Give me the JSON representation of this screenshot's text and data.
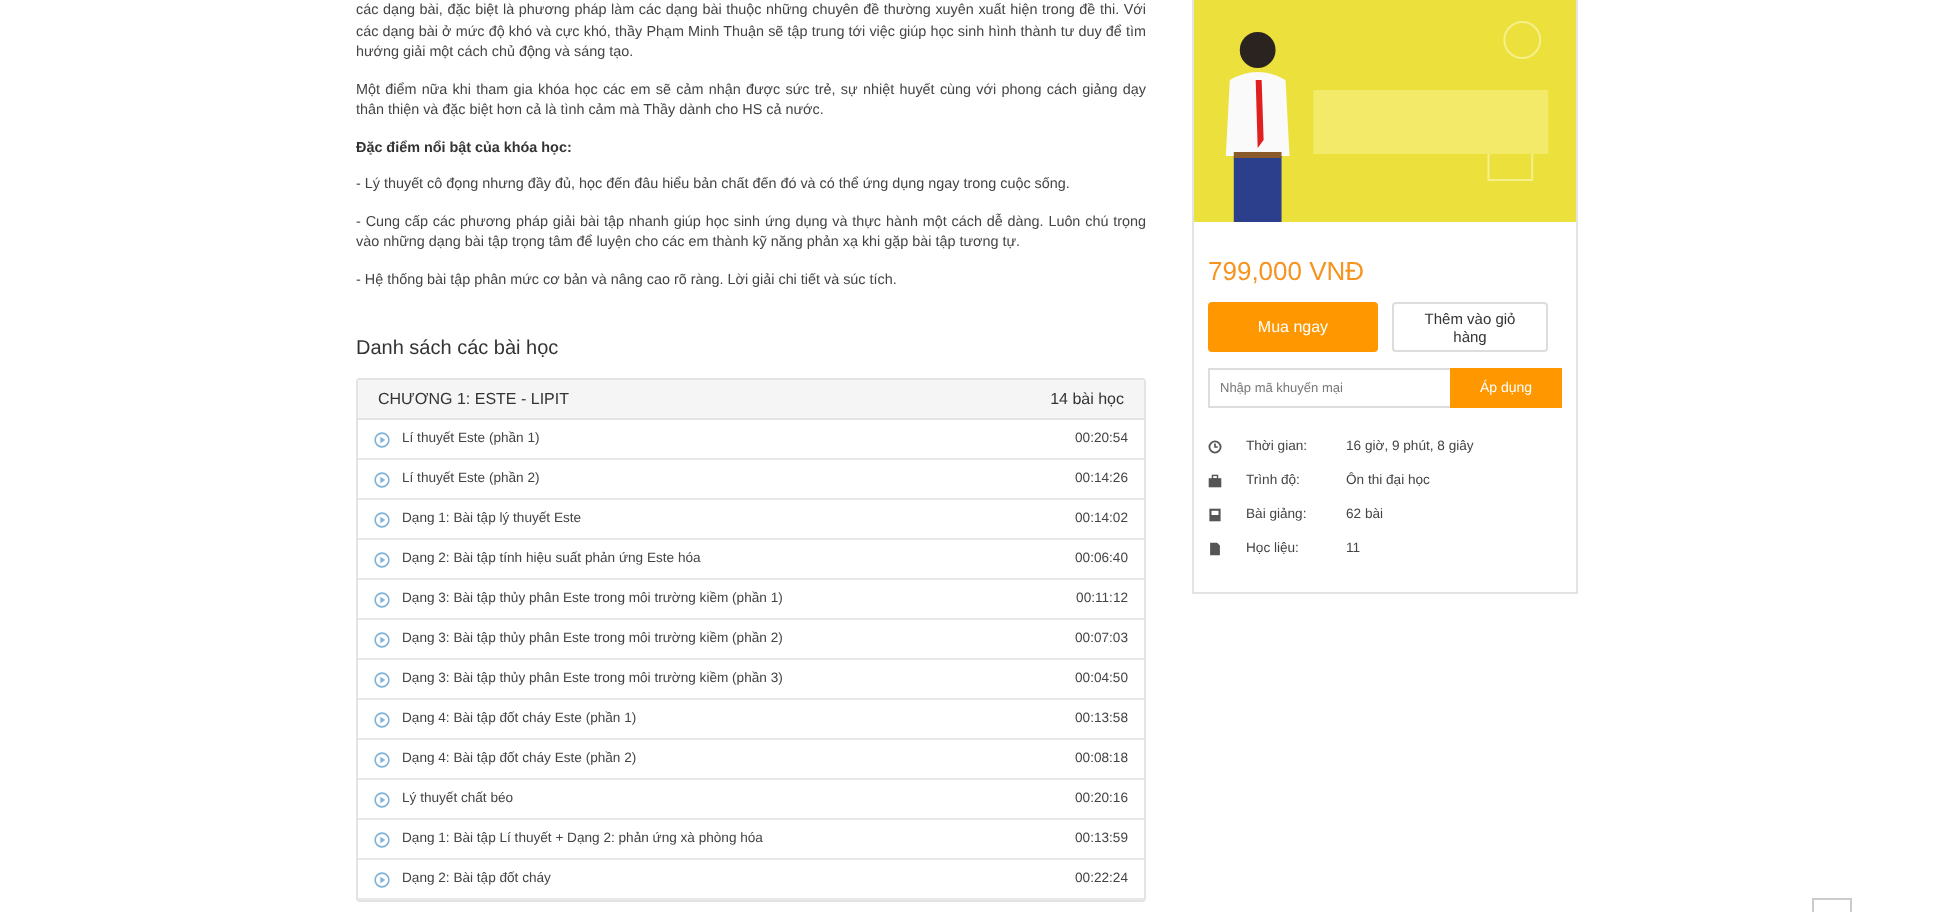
{
  "description": {
    "paragraphs": [
      "các dạng bài, đặc biệt là phương pháp làm các dạng bài thuộc những chuyên đề thường xuyên xuất hiện trong đề thi. Với các dạng bài ở mức độ khó và cực khó, thầy Phạm Minh Thuận sẽ tập trung tới việc giúp học sinh hình thành tư duy để tìm hướng giải một cách chủ động và sáng tạo.",
      "Một điểm nữa khi tham gia khóa học các em sẽ cảm nhận được sức trẻ, sự nhiệt huyết cùng với phong cách giảng dạy thân thiện và đặc biệt hơn cả là tình cảm mà Thầy dành cho HS cả nước."
    ],
    "features_heading": "Đặc điểm nổi bật của khóa học:",
    "features": [
      "- Lý thuyết cô đọng nhưng đầy đủ, học đến đâu hiểu bản chất đến đó và có thể ứng dụng ngay trong cuộc sống.",
      "- Cung cấp các phương pháp giải bài tập nhanh giúp học sinh ứng dụng và thực hành một cách dễ dàng. Luôn chú trọng vào những dạng bài tập trọng tâm để luyện cho các em thành kỹ năng phản xạ khi gặp bài tập tương tự.",
      "- Hệ thống bài tập phân mức cơ bản và nâng cao rõ ràng. Lời giải chi tiết và súc tích."
    ]
  },
  "lessons": {
    "title": "Danh sách các bài học",
    "chapter": {
      "title": "CHƯƠNG 1: ESTE - LIPIT",
      "count": "14 bài học"
    },
    "items": [
      {
        "title": "Lí thuyết Este (phần 1)",
        "duration": "00:20:54"
      },
      {
        "title": "Lí thuyết Este (phần 2)",
        "duration": "00:14:26"
      },
      {
        "title": "Dạng 1: Bài tập lý thuyết Este",
        "duration": "00:14:02"
      },
      {
        "title": "Dạng 2: Bài tập tính hiệu suất phản ứng Este hóa",
        "duration": "00:06:40"
      },
      {
        "title": "Dạng 3: Bài tập thủy phân Este trong môi trường kiềm (phần 1)",
        "duration": "00:11:12"
      },
      {
        "title": "Dạng 3: Bài tập thủy phân Este trong môi trường kiềm (phần 2)",
        "duration": "00:07:03"
      },
      {
        "title": "Dạng 3: Bài tập thủy phân Este trong môi trường kiềm (phần 3)",
        "duration": "00:04:50"
      },
      {
        "title": "Dạng 4: Bài tập đốt cháy Este (phần 1)",
        "duration": "00:13:58"
      },
      {
        "title": "Dạng 4: Bài tập đốt cháy Este (phần 2)",
        "duration": "00:08:18"
      },
      {
        "title": "Lý thuyết chất béo",
        "duration": "00:20:16"
      },
      {
        "title": "Dạng 1: Bài tập Lí thuyết + Dạng 2: phản ứng xà phòng hóa",
        "duration": "00:13:59"
      },
      {
        "title": "Dạng 2: Bài tập đốt cháy",
        "duration": "00:22:24"
      }
    ]
  },
  "course_card": {
    "price": "799,000 VNĐ",
    "buy_button": "Mua ngay",
    "cart_button": "Thêm vào giỏ hàng",
    "promo": {
      "placeholder": "Nhập mã khuyến mại",
      "button": "Áp dụng"
    },
    "info": [
      {
        "kind": "clock",
        "label": "Thời gian:",
        "value": "16 giờ, 9 phút, 8 giây"
      },
      {
        "kind": "level",
        "label": "Trình độ:",
        "value": "Ôn thi đại học"
      },
      {
        "kind": "lectures",
        "label": "Bài giảng:",
        "value": "62 bài"
      },
      {
        "kind": "materials",
        "label": "Học liệu:",
        "value": "11"
      }
    ]
  }
}
